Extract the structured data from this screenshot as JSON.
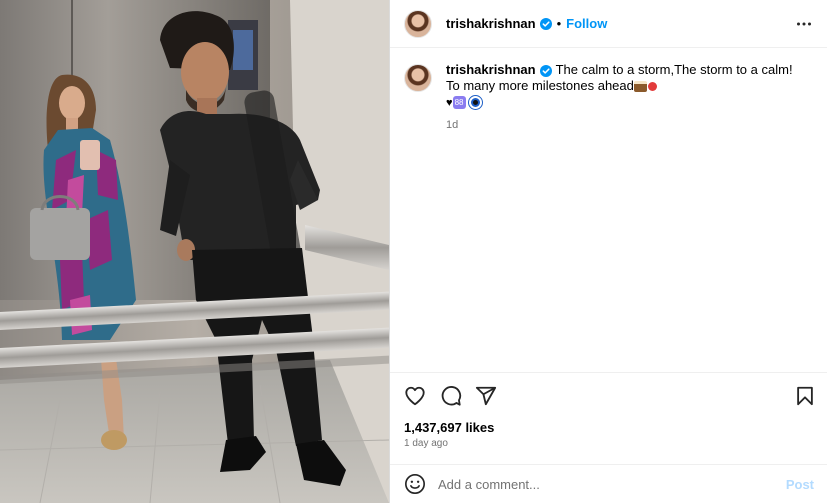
{
  "post": {
    "author": "trishakrishnan",
    "verified": true,
    "follow_label": "Follow",
    "separator": "•",
    "caption_line1": "The calm to a storm,The storm to a calm!",
    "caption_line2": "To many more milestones ahead",
    "caption_emoji_line": "♥",
    "caption_box_emoji": "88",
    "caption_time": "1d",
    "likes": "1,437,697 likes",
    "posted_ago": "1 day ago"
  },
  "comment": {
    "placeholder": "Add a comment...",
    "post_label": "Post"
  },
  "icons": {
    "more": "more-options-icon",
    "like": "heart-icon",
    "comment": "comment-icon",
    "share": "share-icon",
    "save": "bookmark-icon",
    "emoji": "smile-icon",
    "verified": "verified-badge-icon"
  },
  "colors": {
    "accent": "#0095f6",
    "post_disabled": "#b3dbff",
    "muted_text": "#737373",
    "divider": "#efefef"
  }
}
